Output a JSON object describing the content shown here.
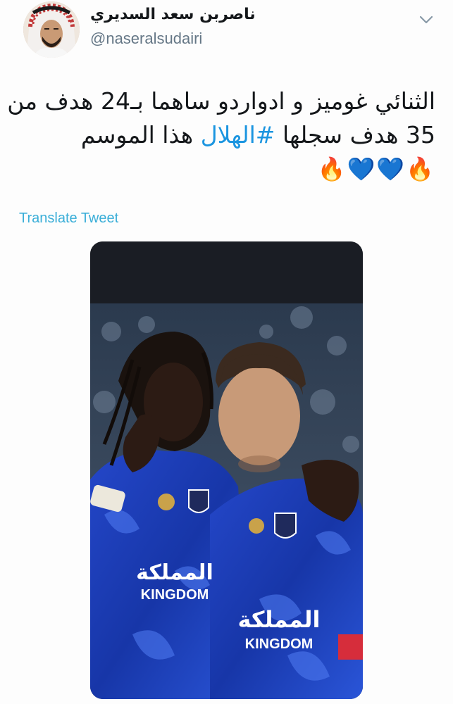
{
  "tweet": {
    "author": {
      "display_name": "ناصربن سعد السديري",
      "handle": "@naseralsudairi",
      "avatar_icon": "user-avatar"
    },
    "text_lines": [
      {
        "segments": [
          {
            "text": "الثنائي غوميز و ادواردو ساهما بـ24 هدف من",
            "hashtag": false
          }
        ]
      },
      {
        "segments": [
          {
            "text": "35 هدف سجلها ",
            "hashtag": false
          },
          {
            "text": "#الهلال",
            "hashtag": true
          },
          {
            "text": " هذا الموسم",
            "hashtag": false
          }
        ]
      }
    ],
    "emojis": "🔥💙💙🔥",
    "translate_label": "Translate Tweet",
    "menu_icon": "chevron-down-icon",
    "media": {
      "shirt_text_arabic": "المملكة",
      "shirt_text_latin": "KINGDOM"
    }
  },
  "colors": {
    "background": "#fdfdfd",
    "text": "#14171a",
    "handle": "#657786",
    "hashtag": "#1b95e0",
    "translate": "#3aaed8",
    "jersey_blue": "#1f3fb8"
  }
}
